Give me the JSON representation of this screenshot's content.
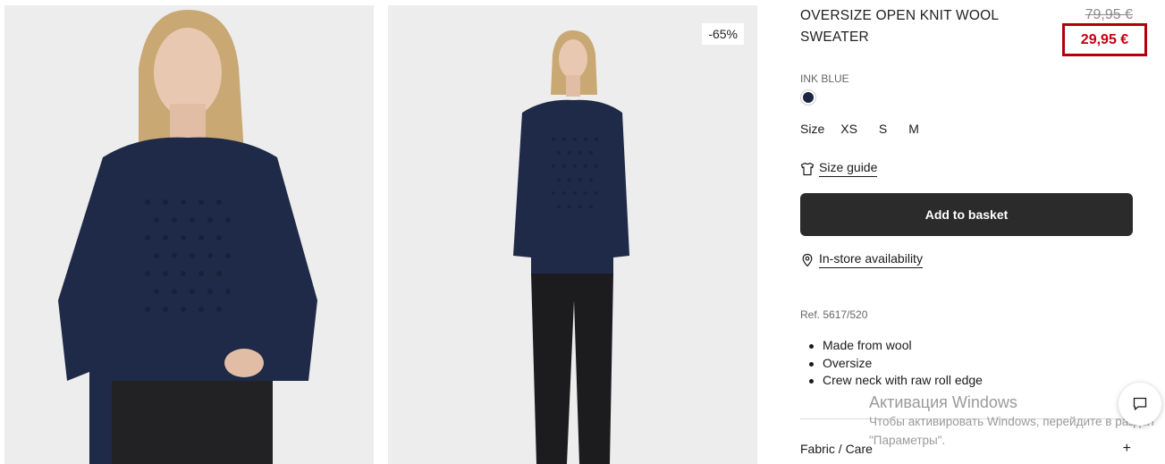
{
  "gallery": {
    "discount_badge": "-65%"
  },
  "product": {
    "title": "OVERSIZE OPEN KNIT WOOL SWEATER",
    "old_price": "79,95 €",
    "new_price": "29,95 €",
    "color_name": "INK BLUE",
    "swatch_color": "#1b2440",
    "size_label": "Size",
    "sizes": [
      "XS",
      "S",
      "M"
    ],
    "size_guide_label": "Size guide",
    "add_to_basket_label": "Add to basket",
    "instore_label": "In-store availability",
    "reference": "Ref. 5617/520",
    "features": [
      "Made from wool",
      "Oversize",
      "Crew neck with raw roll edge"
    ],
    "fabric_care_label": "Fabric / Care",
    "expand_symbol": "+"
  },
  "overlay": {
    "windows_title": "Активация Windows",
    "windows_subtitle": "Чтобы активировать Windows, перейдите в раздел \"Параметры\"."
  },
  "icons": {
    "size_guide": "tshirt-icon",
    "instore": "location-pin-icon",
    "chat": "chat-bubble-icon"
  },
  "colors": {
    "accent_red": "#c4000f",
    "highlight_border": "#b0000b",
    "button_dark": "#2b2b2b"
  }
}
